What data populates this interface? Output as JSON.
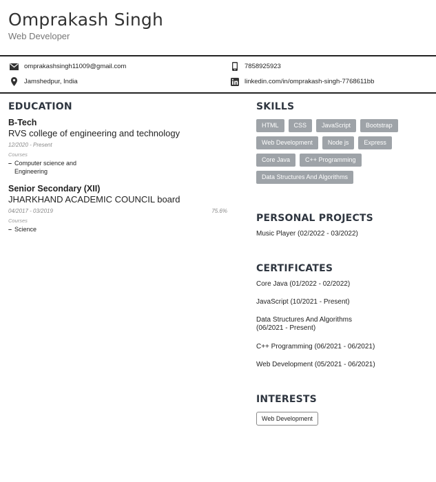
{
  "header": {
    "name": "Omprakash Singh",
    "title": "Web Developer"
  },
  "contact": {
    "email": "omprakashsingh11009@gmail.com",
    "phone": "7858925923",
    "location": "Jamshedpur, India",
    "linkedin": "linkedin.com/in/omprakash-singh-7768611bb"
  },
  "education": {
    "heading": "EDUCATION",
    "items": [
      {
        "degree": "B-Tech",
        "institution": "RVS college of engineering and technology",
        "date": "12/2020 - Present",
        "score": "",
        "courses_label": "Courses",
        "courses": [
          "Computer science and Engineering"
        ]
      },
      {
        "degree": "Senior Secondary (XII)",
        "institution": "JHARKHAND ACADEMIC COUNCIL board",
        "date": "04/2017 - 03/2019",
        "score": "75.6%",
        "courses_label": "Courses",
        "courses": [
          "Science"
        ]
      }
    ]
  },
  "skills": {
    "heading": "SKILLS",
    "items": [
      "HTML",
      "CSS",
      "JavaScript",
      "Bootstrap",
      "Web Development",
      "Node js",
      "Express",
      "Core Java",
      "C++ Programming",
      "Data Structures And Algorithms"
    ]
  },
  "projects": {
    "heading": "PERSONAL PROJECTS",
    "items": [
      "Music Player (02/2022 - 03/2022)"
    ]
  },
  "certificates": {
    "heading": "CERTIFICATES",
    "items": [
      "Core Java (01/2022 - 02/2022)",
      "JavaScript (10/2021 - Present)",
      "Data Structures And Algorithms\n (06/2021 - Present)",
      "C++ Programming (06/2021 - 06/2021)",
      "Web Development (05/2021 - 06/2021)"
    ]
  },
  "interests": {
    "heading": "INTERESTS",
    "items": [
      "Web Development"
    ]
  },
  "colors": {
    "tag_bg": "#9ea3a8",
    "heading": "#2f3640"
  },
  "icons": {
    "email": "envelope-icon",
    "phone": "phone-icon",
    "location": "map-pin-icon",
    "linkedin": "linkedin-icon"
  }
}
